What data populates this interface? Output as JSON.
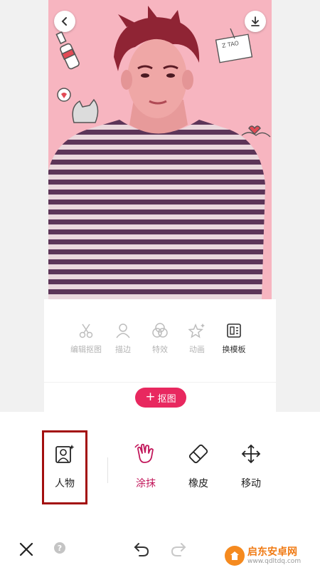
{
  "canvas": {
    "background": "#f7b5c0",
    "sticker_text": "Z TAO"
  },
  "edit_tools": [
    {
      "label": "编辑抠图",
      "icon": "scissors-icon"
    },
    {
      "label": "描边",
      "icon": "person-outline-icon"
    },
    {
      "label": "特效",
      "icon": "effects-circles-icon"
    },
    {
      "label": "动画",
      "icon": "star-sparkle-icon"
    },
    {
      "label": "换模板",
      "icon": "template-icon"
    }
  ],
  "cutout_button": {
    "label": "抠图",
    "icon": "plus-icon"
  },
  "modes": {
    "person": "人物",
    "smear": "涂抹",
    "eraser": "橡皮",
    "move": "移动"
  },
  "colors": {
    "accent": "#e8285f",
    "active_text": "#c2185b",
    "highlight_box": "#a30f0f"
  },
  "watermark": {
    "title": "启东安卓网",
    "url": "www.qdltdq.com"
  }
}
